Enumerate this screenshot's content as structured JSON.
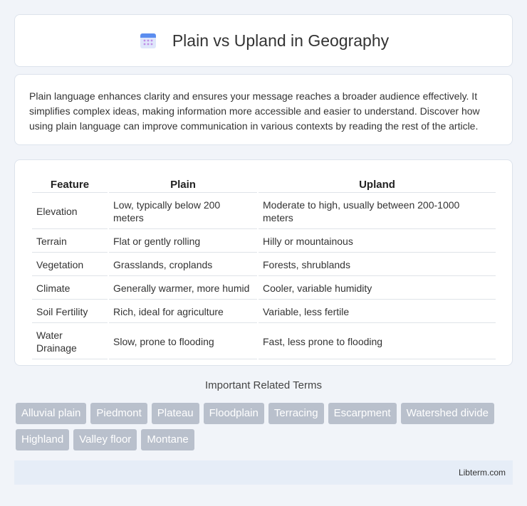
{
  "header": {
    "title": "Plain vs Upland in Geography",
    "icon": "calendar-icon",
    "icon_colors": {
      "top": "#5b8def",
      "body": "#dfe6fb",
      "dots": "#c08ee6"
    }
  },
  "intro": {
    "text": "Plain language enhances clarity and ensures your message reaches a broader audience effectively. It simplifies complex ideas, making information more accessible and easier to understand. Discover how using plain language can improve communication in various contexts by reading the rest of the article."
  },
  "table": {
    "headers": [
      "Feature",
      "Plain",
      "Upland"
    ],
    "rows": [
      [
        "Elevation",
        "Low, typically below 200 meters",
        "Moderate to high, usually between 200-1000 meters"
      ],
      [
        "Terrain",
        "Flat or gently rolling",
        "Hilly or mountainous"
      ],
      [
        "Vegetation",
        "Grasslands, croplands",
        "Forests, shrublands"
      ],
      [
        "Climate",
        "Generally warmer, more humid",
        "Cooler, variable humidity"
      ],
      [
        "Soil Fertility",
        "Rich, ideal for agriculture",
        "Variable, less fertile"
      ],
      [
        "Water Drainage",
        "Slow, prone to flooding",
        "Fast, less prone to flooding"
      ]
    ]
  },
  "related": {
    "title": "Important Related Terms",
    "tags": [
      "Alluvial plain",
      "Piedmont",
      "Plateau",
      "Floodplain",
      "Terracing",
      "Escarpment",
      "Watershed divide",
      "Highland",
      "Valley floor",
      "Montane"
    ],
    "tag_color": "#b9c0cc"
  },
  "footer": {
    "brand": "Libterm.com"
  }
}
